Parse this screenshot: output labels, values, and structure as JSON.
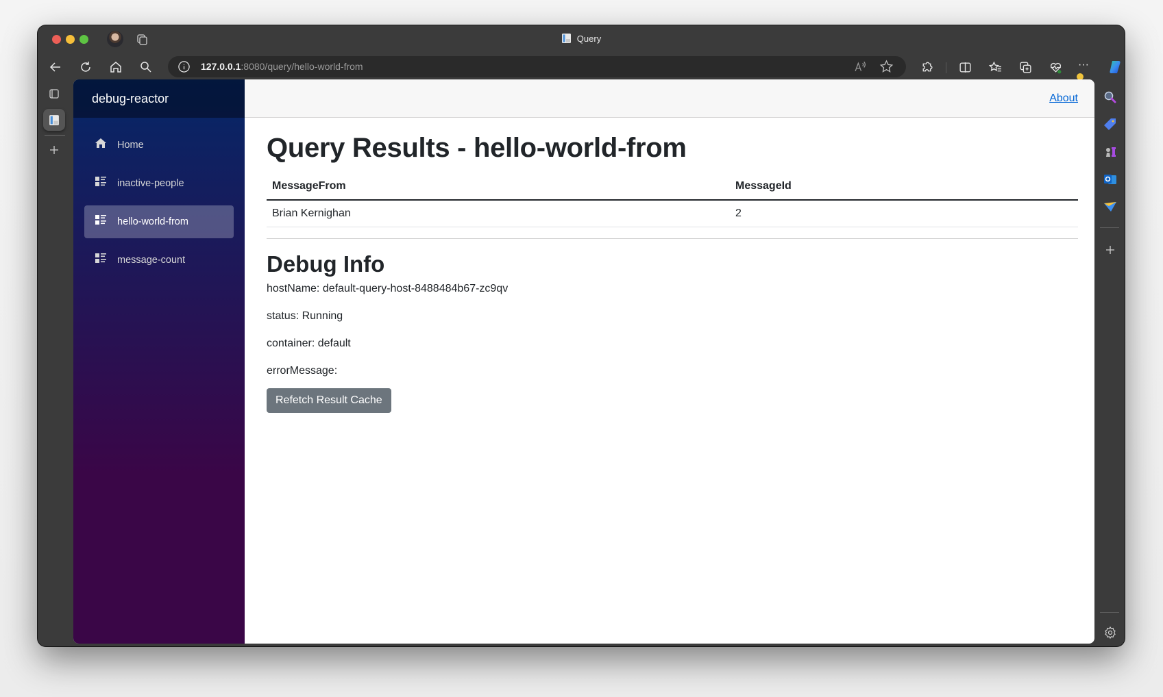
{
  "browser": {
    "tab_title": "Query",
    "url_host": "127.0.0.1",
    "url_rest": ":8080/query/hello-world-from",
    "colors": {
      "traffic_red": "#ed5f57",
      "traffic_yellow": "#f6bf3a",
      "traffic_green": "#5ec443",
      "chrome": "#3b3b3b"
    }
  },
  "app": {
    "brand": "debug-reactor",
    "about_label": "About",
    "nav": [
      {
        "label": "Home",
        "icon": "home-icon",
        "active": false
      },
      {
        "label": "inactive-people",
        "icon": "list-icon",
        "active": false
      },
      {
        "label": "hello-world-from",
        "icon": "list-icon",
        "active": true
      },
      {
        "label": "message-count",
        "icon": "list-icon",
        "active": false
      }
    ],
    "colors": {
      "sidebar_top": "#052767",
      "sidebar_bottom": "#3a0647",
      "link": "#0366d6",
      "button": "#6c757d"
    }
  },
  "page": {
    "title": "Query Results - hello-world-from",
    "table": {
      "columns": [
        "MessageFrom",
        "MessageId"
      ],
      "rows": [
        [
          "Brian Kernighan",
          "2"
        ]
      ]
    },
    "debug": {
      "title": "Debug Info",
      "hostName": "hostName: default-query-host-8488484b67-zc9qv",
      "status": "status: Running",
      "container": "container: default",
      "errorMessage": "errorMessage:"
    },
    "refetch_label": "Refetch Result Cache"
  }
}
